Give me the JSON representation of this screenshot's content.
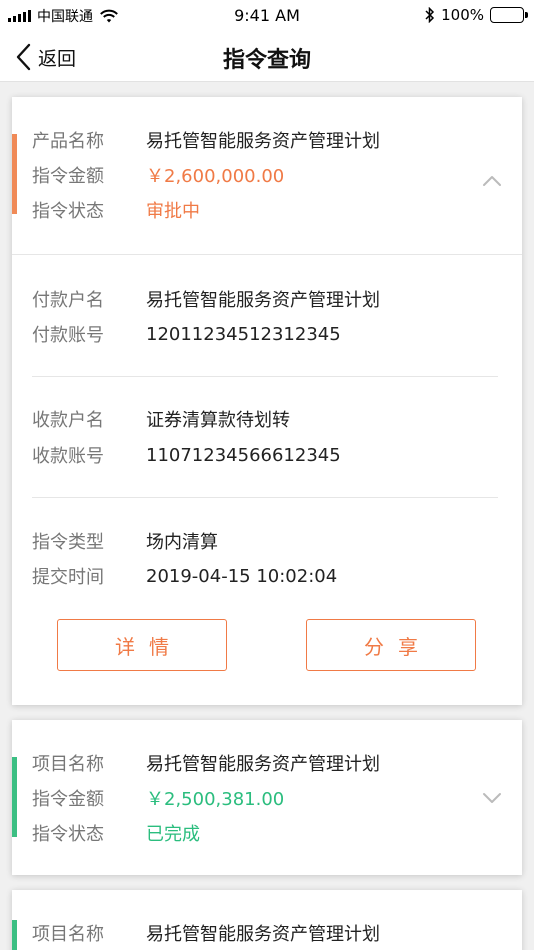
{
  "status_bar": {
    "carrier": "中国联通",
    "time": "9:41 AM",
    "battery": "100%",
    "battery_level": 1.0
  },
  "nav": {
    "back_label": "返回",
    "title": "指令查询"
  },
  "cards": [
    {
      "accent_color": "#f08a57",
      "expanded": true,
      "summary": [
        {
          "label": "产品名称",
          "value": "易托管智能服务资产管理计划"
        },
        {
          "label": "指令金额",
          "value": "￥2,600,000.00"
        },
        {
          "label": "指令状态",
          "value": "审批中"
        }
      ],
      "payer": [
        {
          "label": "付款户名",
          "value": "易托管智能服务资产管理计划"
        },
        {
          "label": "付款账号",
          "value": "12011234512312345"
        }
      ],
      "payee": [
        {
          "label": "收款户名",
          "value": "证券清算款待划转"
        },
        {
          "label": "收款账号",
          "value": "11071234566612345"
        }
      ],
      "meta": [
        {
          "label": "指令类型",
          "value": "场内清算"
        },
        {
          "label": "提交时间",
          "value": "2019-04-15 10:02:04"
        }
      ],
      "buttons": {
        "detail": "详情",
        "share": "分享"
      }
    },
    {
      "accent_color": "#3cbf83",
      "expanded": false,
      "summary": [
        {
          "label": "项目名称",
          "value": "易托管智能服务资产管理计划"
        },
        {
          "label": "指令金额",
          "value": "￥2,500,381.00"
        },
        {
          "label": "指令状态",
          "value": "已完成"
        }
      ]
    },
    {
      "accent_color": "#3cbf83",
      "summary": [
        {
          "label": "项目名称",
          "value": "易托管智能服务资产管理计划"
        }
      ]
    }
  ],
  "colors": {
    "orange": "#f07a46",
    "green": "#2bbd7e",
    "label": "#777777"
  },
  "icons": {
    "back": "chevron-left-icon",
    "collapse": "chevron-up-icon",
    "expand": "chevron-down-icon",
    "wifi": "wifi-icon",
    "bluetooth": "bluetooth-icon",
    "battery": "battery-icon",
    "signal": "signal-icon"
  }
}
